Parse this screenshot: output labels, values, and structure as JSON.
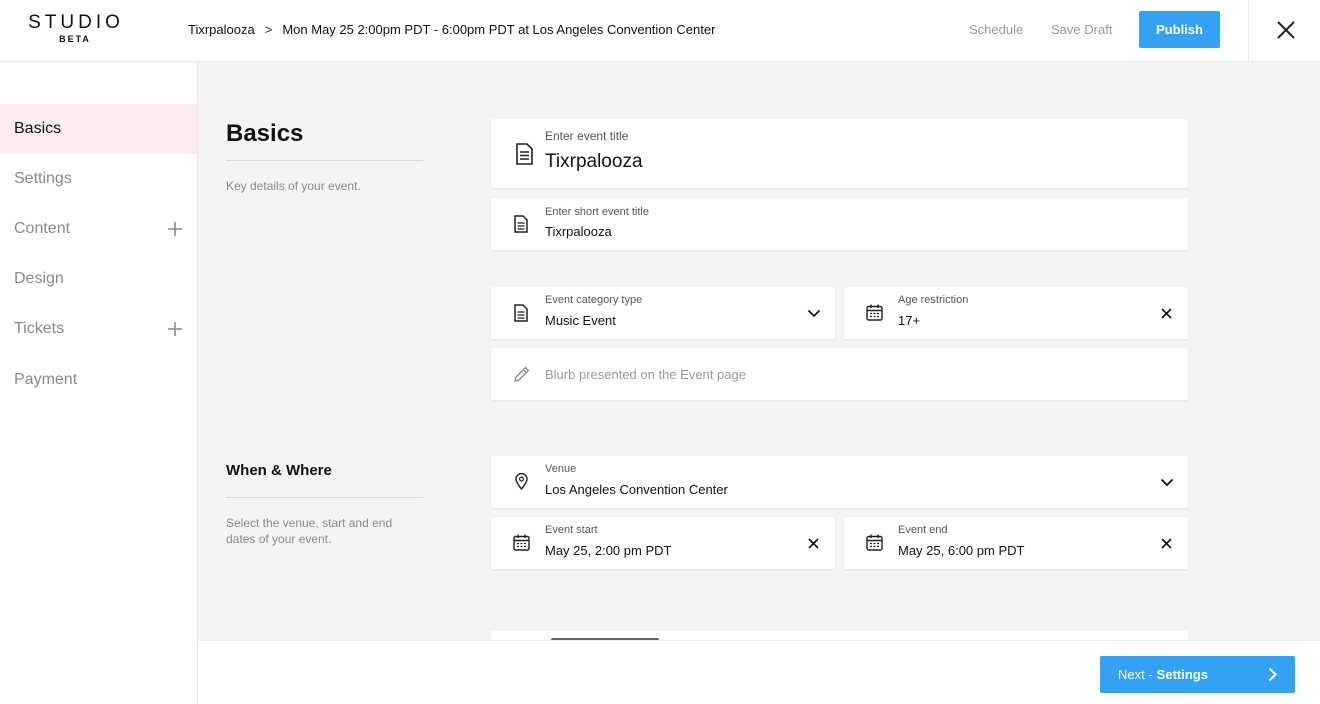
{
  "app": {
    "logo_line1": "STUDIO",
    "logo_line2": "BETA"
  },
  "header": {
    "breadcrumb_event": "Tixrpalooza",
    "breadcrumb_sep": ">",
    "breadcrumb_detail": "Mon May 25 2:00pm PDT - 6:00pm PDT at Los Angeles Convention Center",
    "schedule_label": "Schedule",
    "save_draft_label": "Save Draft",
    "publish_label": "Publish"
  },
  "sidebar": {
    "items": [
      {
        "label": "Basics",
        "active": true
      },
      {
        "label": "Settings"
      },
      {
        "label": "Content",
        "has_add": true
      },
      {
        "label": "Design"
      },
      {
        "label": "Tickets",
        "has_add": true
      },
      {
        "label": "Payment"
      }
    ]
  },
  "basics": {
    "title": "Basics",
    "description": "Key details of your event.",
    "event_title_label": "Enter event title",
    "event_title_value": "Tixrpalooza",
    "short_title_label": "Enter short event title",
    "short_title_value": "Tixrpalooza",
    "category_label": "Event category type",
    "category_value": "Music Event",
    "age_label": "Age restriction",
    "age_value": "17+",
    "blurb_placeholder": "Blurb presented on the Event page"
  },
  "when_where": {
    "title": "When & Where",
    "description": "Select the venue, start and end dates of your event.",
    "venue_label": "Venue",
    "venue_value": "Los Angeles Convention Center",
    "start_label": "Event start",
    "start_value": "May 25, 2:00 pm PDT",
    "end_label": "Event end",
    "end_value": "May 25, 6:00 pm PDT"
  },
  "footer": {
    "next_prefix": "Next - ",
    "next_target": "Settings"
  },
  "colors": {
    "accent": "#34a2f2",
    "active_nav_bg": "#fcecef"
  },
  "icons": [
    "document-icon",
    "calendar-icon",
    "pencil-icon",
    "location-pin-icon",
    "close-icon",
    "chevron-down-icon",
    "plus-icon",
    "chevron-right-icon"
  ]
}
